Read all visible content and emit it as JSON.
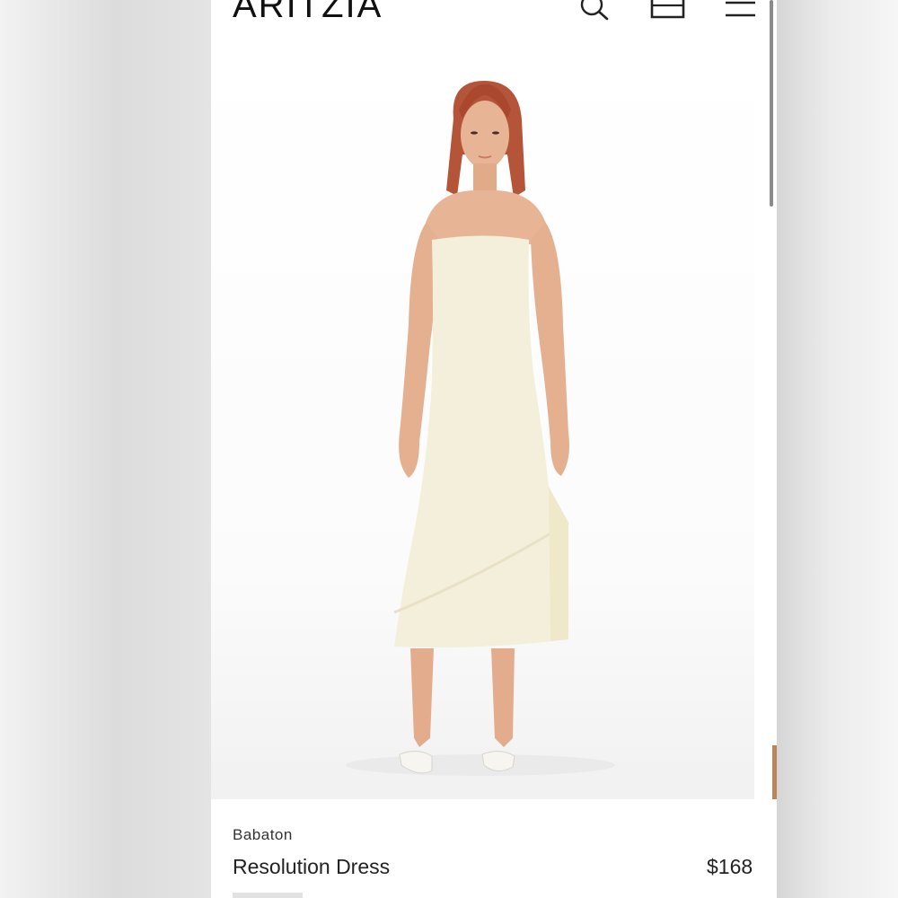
{
  "header": {
    "logo": "ARITZIA",
    "icons": [
      "search-icon",
      "bag-icon",
      "menu-icon"
    ]
  },
  "product": {
    "image": "model-in-strapless-cream-dress",
    "brand": "Babaton",
    "name": "Resolution Dress",
    "price": "$168"
  },
  "colors": {
    "dress": "#f4efdb",
    "hair": "#b4553a",
    "skin": "#e7b596",
    "text": "#222222"
  }
}
